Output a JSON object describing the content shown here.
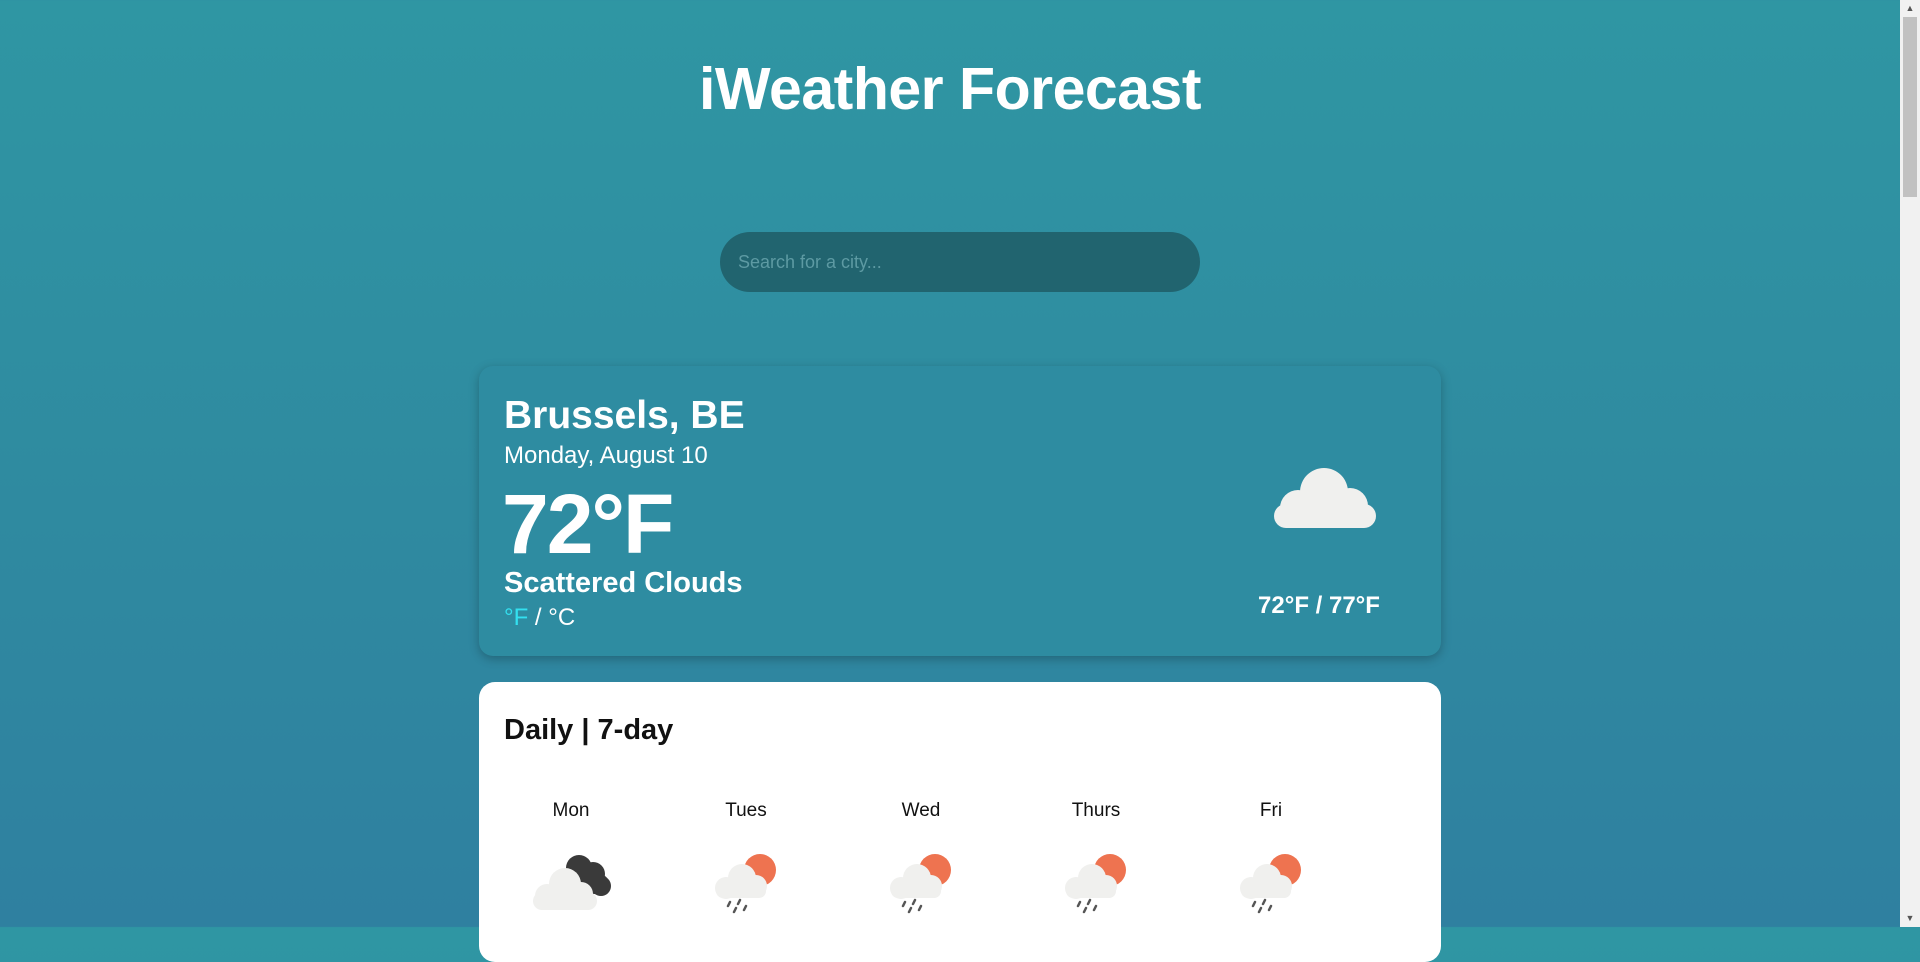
{
  "header": {
    "title": "iWeather Forecast"
  },
  "search": {
    "placeholder": "Search for a city...",
    "value": ""
  },
  "current": {
    "city": "Brussels, BE",
    "date": "Monday, August 10",
    "temperature": "72°F",
    "condition": "Scattered Clouds",
    "unit_f": "°F",
    "unit_separator": " / ",
    "unit_c": "°C",
    "active_unit": "F",
    "high_low": "72°F / 77°F",
    "icon": "cloud-icon"
  },
  "daily": {
    "title": "Daily | 7-day",
    "days": [
      {
        "label": "Mon",
        "icon": "dark-clouds-icon"
      },
      {
        "label": "Tues",
        "icon": "sun-rain-icon"
      },
      {
        "label": "Wed",
        "icon": "sun-rain-icon"
      },
      {
        "label": "Thurs",
        "icon": "sun-rain-icon"
      },
      {
        "label": "Fri",
        "icon": "sun-rain-icon"
      }
    ]
  },
  "colors": {
    "background": "#2f8fa2",
    "card": "#2e8ca1",
    "search_bg": "#21646f",
    "active_unit": "#33e0f0",
    "sun": "#ee7350",
    "cloud": "#f0f0ee",
    "dark_cloud": "#3a3a3a"
  }
}
